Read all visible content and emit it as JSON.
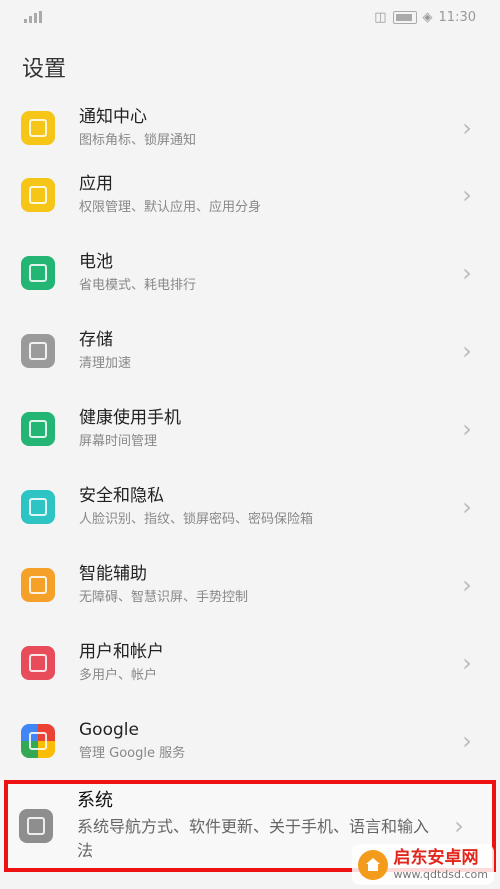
{
  "status_bar": {
    "time": "11:30"
  },
  "header": {
    "title": "设置"
  },
  "items": [
    {
      "title": "通知中心",
      "subtitle": "图标角标、锁屏通知",
      "icon": "bell-icon",
      "color": "#f5c518"
    },
    {
      "title": "应用",
      "subtitle": "权限管理、默认应用、应用分身",
      "icon": "apps-icon",
      "color": "#f5c518"
    },
    {
      "title": "电池",
      "subtitle": "省电模式、耗电排行",
      "icon": "battery-icon",
      "color": "#22b573"
    },
    {
      "title": "存储",
      "subtitle": "清理加速",
      "icon": "storage-icon",
      "color": "#9a9a9a"
    },
    {
      "title": "健康使用手机",
      "subtitle": "屏幕时间管理",
      "icon": "hourglass-icon",
      "color": "#22b573"
    },
    {
      "title": "安全和隐私",
      "subtitle": "人脸识别、指纹、锁屏密码、密码保险箱",
      "icon": "shield-icon",
      "color": "#2ec4c4"
    },
    {
      "title": "智能辅助",
      "subtitle": "无障碍、智慧识屏、手势控制",
      "icon": "hand-icon",
      "color": "#f5a028"
    },
    {
      "title": "用户和帐户",
      "subtitle": "多用户、帐户",
      "icon": "user-icon",
      "color": "#e84c5a"
    },
    {
      "title": "Google",
      "subtitle": "管理 Google 服务",
      "icon": "google-icon",
      "color": "#4285f4"
    }
  ],
  "system_item": {
    "title": "系统",
    "subtitle": "系统导航方式、软件更新、关于手机、语言和输入法",
    "icon": "phone-icon",
    "color": "#8e8e8e"
  },
  "watermark": {
    "name": "启东安卓网",
    "url": "www.qdtdsd.com"
  },
  "highlight_color": "#ee1111"
}
